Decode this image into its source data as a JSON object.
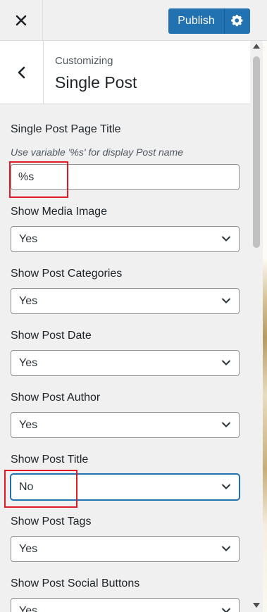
{
  "header": {
    "close_icon": "close-icon",
    "publish_label": "Publish",
    "settings_icon": "gear-icon",
    "accent": "#2271b1"
  },
  "section": {
    "breadcrumb": "Customizing",
    "title": "Single Post",
    "back_icon": "chevron-left-icon"
  },
  "controls": {
    "page_title": {
      "label": "Single Post Page Title",
      "description": "Use variable '%s' for display Post name",
      "value": "%s"
    },
    "selects": [
      {
        "label": "Show Media Image",
        "value": "Yes"
      },
      {
        "label": "Show Post Categories",
        "value": "Yes"
      },
      {
        "label": "Show Post Date",
        "value": "Yes"
      },
      {
        "label": "Show Post Author",
        "value": "Yes"
      },
      {
        "label": "Show Post Title",
        "value": "No"
      },
      {
        "label": "Show Post Tags",
        "value": "Yes"
      },
      {
        "label": "Show Post Social Buttons",
        "value": "Yes"
      }
    ]
  },
  "annotation_color": "#e01b24"
}
